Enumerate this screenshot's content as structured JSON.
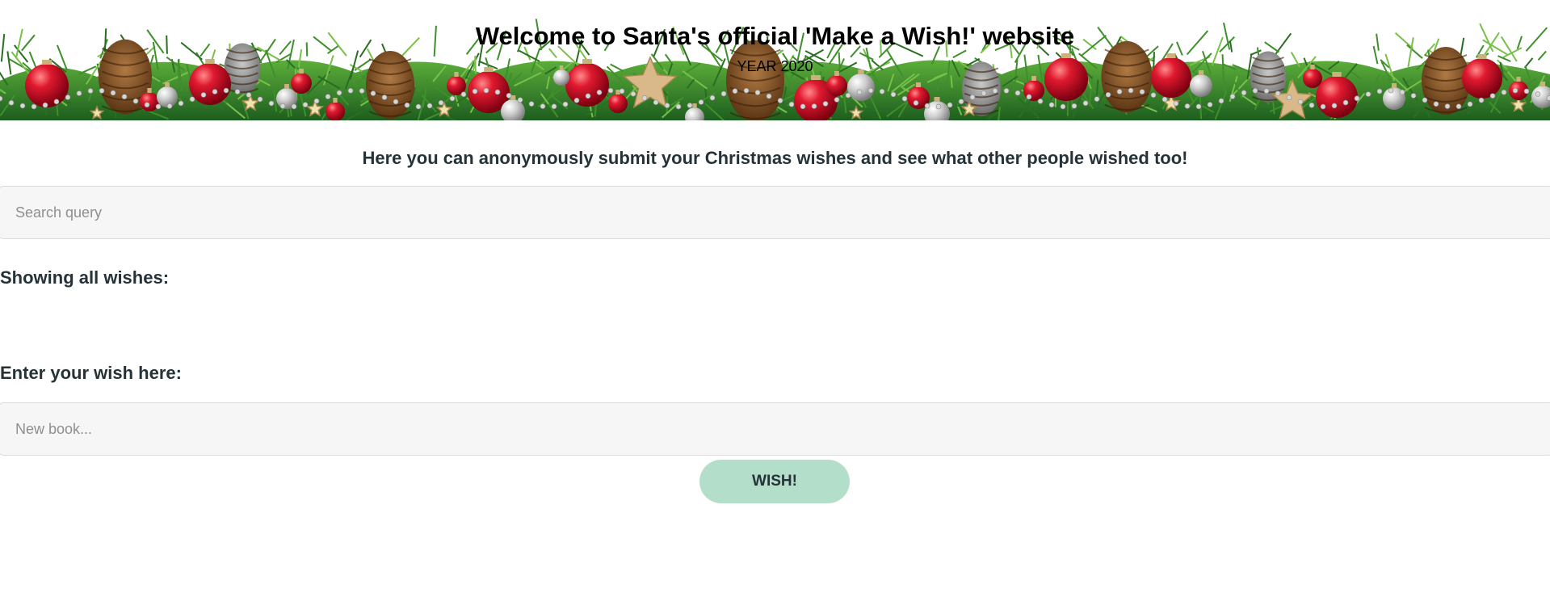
{
  "header": {
    "title": "Welcome to Santa's official 'Make a Wish!' website",
    "year": "YEAR 2020"
  },
  "intro": {
    "text": "Here you can anonymously submit your Christmas wishes and see what other people wished too!"
  },
  "search": {
    "placeholder": "Search query",
    "value": ""
  },
  "wishes": {
    "heading": "Showing all wishes:",
    "items": []
  },
  "wish_form": {
    "heading": "Enter your wish here:",
    "placeholder": "New book...",
    "value": "",
    "button_label": "WISH!"
  },
  "colors": {
    "text_dark": "#253237",
    "button_bg": "#b3dfca",
    "input_bg": "#f6f6f6",
    "ornament_red": "#c8102e",
    "pine_green": "#2e7d32",
    "pinecone_brown": "#8b5a2b"
  }
}
